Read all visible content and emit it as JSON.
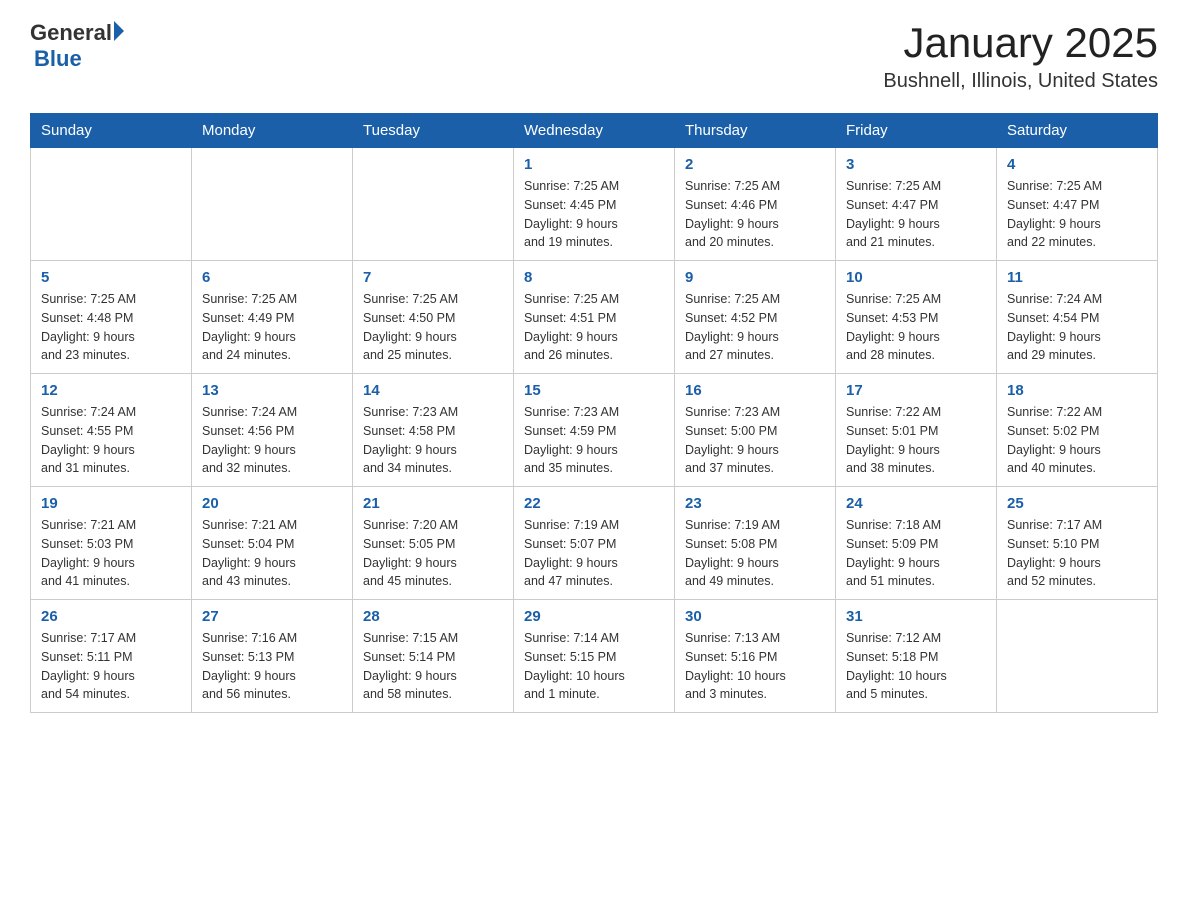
{
  "header": {
    "logo_general": "General",
    "logo_blue": "Blue",
    "title": "January 2025",
    "subtitle": "Bushnell, Illinois, United States"
  },
  "weekdays": [
    "Sunday",
    "Monday",
    "Tuesday",
    "Wednesday",
    "Thursday",
    "Friday",
    "Saturday"
  ],
  "weeks": [
    [
      {
        "day": "",
        "info": ""
      },
      {
        "day": "",
        "info": ""
      },
      {
        "day": "",
        "info": ""
      },
      {
        "day": "1",
        "info": "Sunrise: 7:25 AM\nSunset: 4:45 PM\nDaylight: 9 hours\nand 19 minutes."
      },
      {
        "day": "2",
        "info": "Sunrise: 7:25 AM\nSunset: 4:46 PM\nDaylight: 9 hours\nand 20 minutes."
      },
      {
        "day": "3",
        "info": "Sunrise: 7:25 AM\nSunset: 4:47 PM\nDaylight: 9 hours\nand 21 minutes."
      },
      {
        "day": "4",
        "info": "Sunrise: 7:25 AM\nSunset: 4:47 PM\nDaylight: 9 hours\nand 22 minutes."
      }
    ],
    [
      {
        "day": "5",
        "info": "Sunrise: 7:25 AM\nSunset: 4:48 PM\nDaylight: 9 hours\nand 23 minutes."
      },
      {
        "day": "6",
        "info": "Sunrise: 7:25 AM\nSunset: 4:49 PM\nDaylight: 9 hours\nand 24 minutes."
      },
      {
        "day": "7",
        "info": "Sunrise: 7:25 AM\nSunset: 4:50 PM\nDaylight: 9 hours\nand 25 minutes."
      },
      {
        "day": "8",
        "info": "Sunrise: 7:25 AM\nSunset: 4:51 PM\nDaylight: 9 hours\nand 26 minutes."
      },
      {
        "day": "9",
        "info": "Sunrise: 7:25 AM\nSunset: 4:52 PM\nDaylight: 9 hours\nand 27 minutes."
      },
      {
        "day": "10",
        "info": "Sunrise: 7:25 AM\nSunset: 4:53 PM\nDaylight: 9 hours\nand 28 minutes."
      },
      {
        "day": "11",
        "info": "Sunrise: 7:24 AM\nSunset: 4:54 PM\nDaylight: 9 hours\nand 29 minutes."
      }
    ],
    [
      {
        "day": "12",
        "info": "Sunrise: 7:24 AM\nSunset: 4:55 PM\nDaylight: 9 hours\nand 31 minutes."
      },
      {
        "day": "13",
        "info": "Sunrise: 7:24 AM\nSunset: 4:56 PM\nDaylight: 9 hours\nand 32 minutes."
      },
      {
        "day": "14",
        "info": "Sunrise: 7:23 AM\nSunset: 4:58 PM\nDaylight: 9 hours\nand 34 minutes."
      },
      {
        "day": "15",
        "info": "Sunrise: 7:23 AM\nSunset: 4:59 PM\nDaylight: 9 hours\nand 35 minutes."
      },
      {
        "day": "16",
        "info": "Sunrise: 7:23 AM\nSunset: 5:00 PM\nDaylight: 9 hours\nand 37 minutes."
      },
      {
        "day": "17",
        "info": "Sunrise: 7:22 AM\nSunset: 5:01 PM\nDaylight: 9 hours\nand 38 minutes."
      },
      {
        "day": "18",
        "info": "Sunrise: 7:22 AM\nSunset: 5:02 PM\nDaylight: 9 hours\nand 40 minutes."
      }
    ],
    [
      {
        "day": "19",
        "info": "Sunrise: 7:21 AM\nSunset: 5:03 PM\nDaylight: 9 hours\nand 41 minutes."
      },
      {
        "day": "20",
        "info": "Sunrise: 7:21 AM\nSunset: 5:04 PM\nDaylight: 9 hours\nand 43 minutes."
      },
      {
        "day": "21",
        "info": "Sunrise: 7:20 AM\nSunset: 5:05 PM\nDaylight: 9 hours\nand 45 minutes."
      },
      {
        "day": "22",
        "info": "Sunrise: 7:19 AM\nSunset: 5:07 PM\nDaylight: 9 hours\nand 47 minutes."
      },
      {
        "day": "23",
        "info": "Sunrise: 7:19 AM\nSunset: 5:08 PM\nDaylight: 9 hours\nand 49 minutes."
      },
      {
        "day": "24",
        "info": "Sunrise: 7:18 AM\nSunset: 5:09 PM\nDaylight: 9 hours\nand 51 minutes."
      },
      {
        "day": "25",
        "info": "Sunrise: 7:17 AM\nSunset: 5:10 PM\nDaylight: 9 hours\nand 52 minutes."
      }
    ],
    [
      {
        "day": "26",
        "info": "Sunrise: 7:17 AM\nSunset: 5:11 PM\nDaylight: 9 hours\nand 54 minutes."
      },
      {
        "day": "27",
        "info": "Sunrise: 7:16 AM\nSunset: 5:13 PM\nDaylight: 9 hours\nand 56 minutes."
      },
      {
        "day": "28",
        "info": "Sunrise: 7:15 AM\nSunset: 5:14 PM\nDaylight: 9 hours\nand 58 minutes."
      },
      {
        "day": "29",
        "info": "Sunrise: 7:14 AM\nSunset: 5:15 PM\nDaylight: 10 hours\nand 1 minute."
      },
      {
        "day": "30",
        "info": "Sunrise: 7:13 AM\nSunset: 5:16 PM\nDaylight: 10 hours\nand 3 minutes."
      },
      {
        "day": "31",
        "info": "Sunrise: 7:12 AM\nSunset: 5:18 PM\nDaylight: 10 hours\nand 5 minutes."
      },
      {
        "day": "",
        "info": ""
      }
    ]
  ]
}
